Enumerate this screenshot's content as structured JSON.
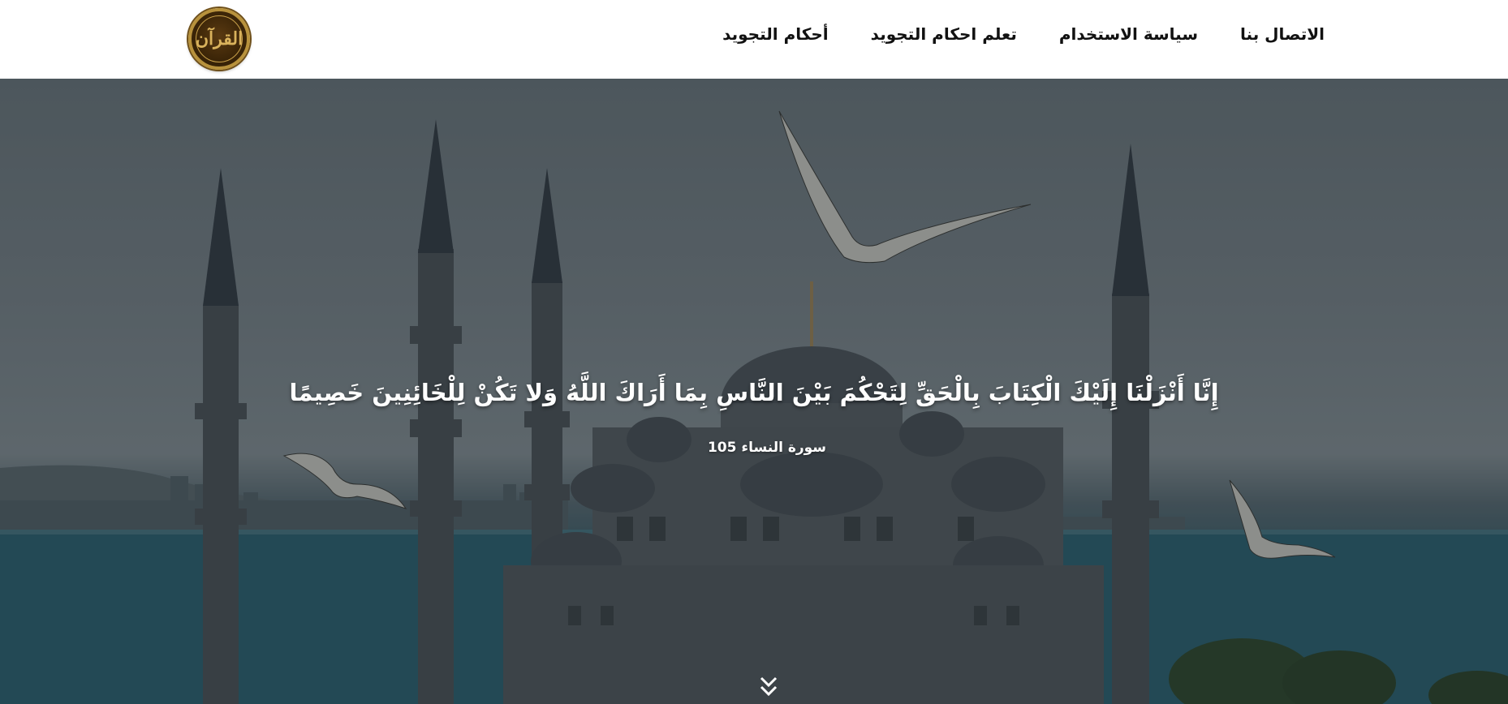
{
  "header": {
    "logo_icon": "quran-emblem-logo",
    "logo_text": "القرآن",
    "nav_items": [
      {
        "label": "أحكام التجويد"
      },
      {
        "label": "تعلم احكام التجويد"
      },
      {
        "label": "سياسة الاستخدام"
      },
      {
        "label": "الاتصال بنا"
      }
    ]
  },
  "hero": {
    "verse": "إِنَّا أَنْزَلْنَا إِلَيْكَ الْكِتَابَ بِالْحَقِّ لِتَحْكُمَ بَيْنَ النَّاسِ بِمَا أَرَاكَ اللَّهُ وَلا تَكُنْ لِلْخَائِنِينَ خَصِيمًا",
    "reference": "سورة النساء 105",
    "background_image": "mosque-minarets-seagulls-photo",
    "scroll_icon": "double-chevron-down-icon"
  },
  "colors": {
    "nav_bg": "#ffffff",
    "nav_text": "#111111",
    "logo_gold": "#b8923c",
    "hero_text": "#ffffff"
  }
}
